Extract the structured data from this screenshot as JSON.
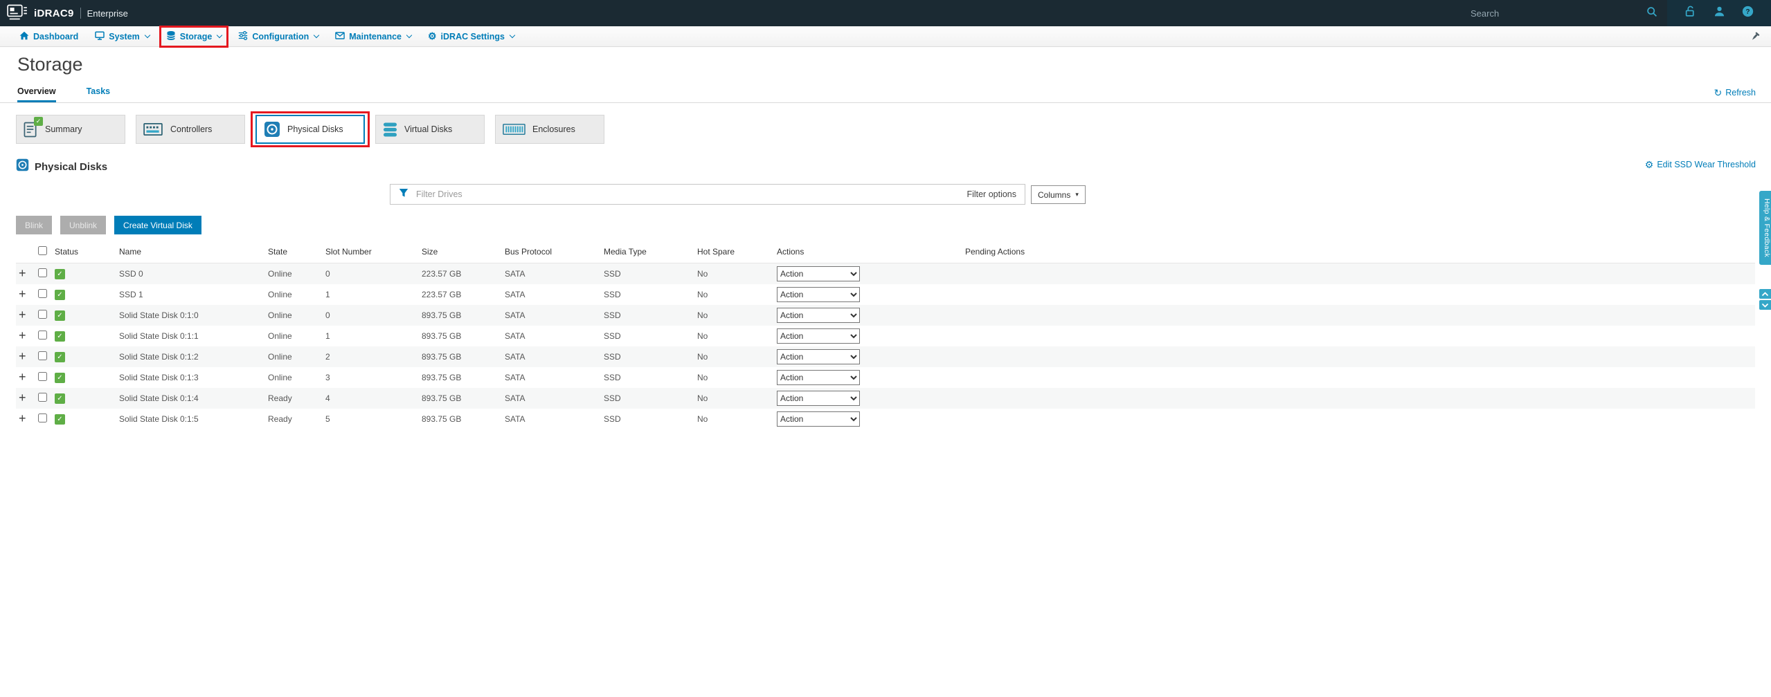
{
  "colors": {
    "accent_blue": "#007db8",
    "topbar_bg": "#1b2a33",
    "icon_teal": "#35a7c8",
    "status_green": "#5fae46",
    "annotation_red": "#e4181f"
  },
  "icons": {
    "plus": "+",
    "check": "✓",
    "refresh": "↻",
    "gear": "⚙",
    "columns_arrow": "▾"
  },
  "topbar": {
    "brand": "iDRAC9",
    "edition": "Enterprise",
    "search_placeholder": "Search"
  },
  "nav": {
    "items": [
      {
        "label": "Dashboard"
      },
      {
        "label": "System"
      },
      {
        "label": "Storage"
      },
      {
        "label": "Configuration"
      },
      {
        "label": "Maintenance"
      },
      {
        "label": "iDRAC Settings"
      }
    ]
  },
  "page": {
    "title": "Storage",
    "tabs": [
      {
        "label": "Overview"
      },
      {
        "label": "Tasks"
      }
    ],
    "refresh_label": "Refresh"
  },
  "cards": [
    {
      "label": "Summary"
    },
    {
      "label": "Controllers"
    },
    {
      "label": "Physical Disks"
    },
    {
      "label": "Virtual Disks"
    },
    {
      "label": "Enclosures"
    }
  ],
  "section": {
    "title": "Physical Disks",
    "edit_link": "Edit SSD Wear Threshold"
  },
  "filter": {
    "placeholder": "Filter Drives",
    "options_label": "Filter options",
    "columns_label": "Columns"
  },
  "toolbar": {
    "blink": "Blink",
    "unblink": "Unblink",
    "create_virtual_disk": "Create Virtual Disk"
  },
  "table": {
    "headers": {
      "status": "Status",
      "name": "Name",
      "state": "State",
      "slot": "Slot Number",
      "size": "Size",
      "bus": "Bus Protocol",
      "media": "Media Type",
      "hot_spare": "Hot Spare",
      "actions": "Actions",
      "pending": "Pending Actions"
    },
    "action_label": "Action",
    "rows": [
      {
        "name": "SSD 0",
        "state": "Online",
        "slot": "0",
        "size": "223.57 GB",
        "bus": "SATA",
        "media": "SSD",
        "hot_spare": "No"
      },
      {
        "name": "SSD 1",
        "state": "Online",
        "slot": "1",
        "size": "223.57 GB",
        "bus": "SATA",
        "media": "SSD",
        "hot_spare": "No"
      },
      {
        "name": "Solid State Disk 0:1:0",
        "state": "Online",
        "slot": "0",
        "size": "893.75 GB",
        "bus": "SATA",
        "media": "SSD",
        "hot_spare": "No"
      },
      {
        "name": "Solid State Disk 0:1:1",
        "state": "Online",
        "slot": "1",
        "size": "893.75 GB",
        "bus": "SATA",
        "media": "SSD",
        "hot_spare": "No"
      },
      {
        "name": "Solid State Disk 0:1:2",
        "state": "Online",
        "slot": "2",
        "size": "893.75 GB",
        "bus": "SATA",
        "media": "SSD",
        "hot_spare": "No"
      },
      {
        "name": "Solid State Disk 0:1:3",
        "state": "Online",
        "slot": "3",
        "size": "893.75 GB",
        "bus": "SATA",
        "media": "SSD",
        "hot_spare": "No"
      },
      {
        "name": "Solid State Disk 0:1:4",
        "state": "Ready",
        "slot": "4",
        "size": "893.75 GB",
        "bus": "SATA",
        "media": "SSD",
        "hot_spare": "No"
      },
      {
        "name": "Solid State Disk 0:1:5",
        "state": "Ready",
        "slot": "5",
        "size": "893.75 GB",
        "bus": "SATA",
        "media": "SSD",
        "hot_spare": "No"
      }
    ]
  },
  "help_tab": {
    "label": "Help & Feedback"
  }
}
